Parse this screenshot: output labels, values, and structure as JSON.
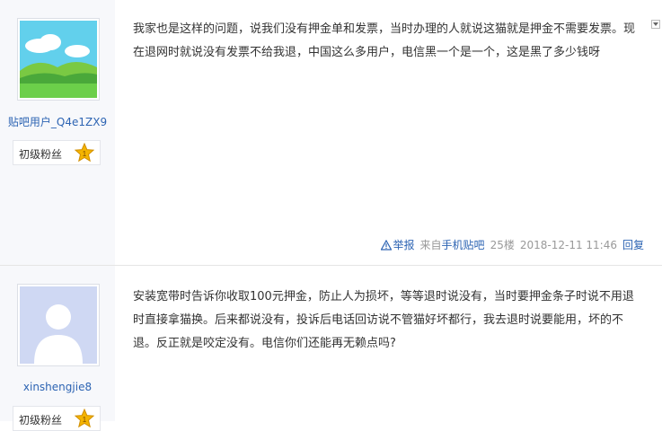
{
  "posts": [
    {
      "username": "贴吧用户_Q4e1ZX9",
      "badge_label": "初级粉丝",
      "badge_level": "1",
      "content": "我家也是这样的问题，说我们没有押金单和发票，当时办理的人就说这猫就是押金不需要发票。现在退网时就说没有发票不给我退，中国这么多用户，电信黑一个是一个，这是黑了多少钱呀",
      "report_label": "举报",
      "source_prefix": "来自",
      "source_link": "手机贴吧",
      "floor": "25楼",
      "time": "2018-12-11 11:46",
      "reply_label": "回复"
    },
    {
      "username": "xinshengjie8",
      "badge_label": "初级粉丝",
      "badge_level": "1",
      "content": "安装宽带时告诉你收取100元押金，防止人为损坏，等等退时说没有，当时要押金条子时说不用退时直接拿猫换。后来都说没有，投诉后电话回访说不管猫好坏都行，我去退时说要能用，坏的不退。反正就是咬定没有。电信你们还能再无赖点吗?"
    }
  ],
  "colors": {
    "link": "#2d64b3",
    "sidebar_bg": "#f7f8fb",
    "meta_text": "#999999",
    "badge_star": "#f4b400"
  },
  "icons": {
    "report": "warning-triangle-icon",
    "badge": "star-icon",
    "dropdown": "dropdown-arrow-icon",
    "avatar_1": "landscape-avatar",
    "avatar_2": "default-user-avatar"
  }
}
